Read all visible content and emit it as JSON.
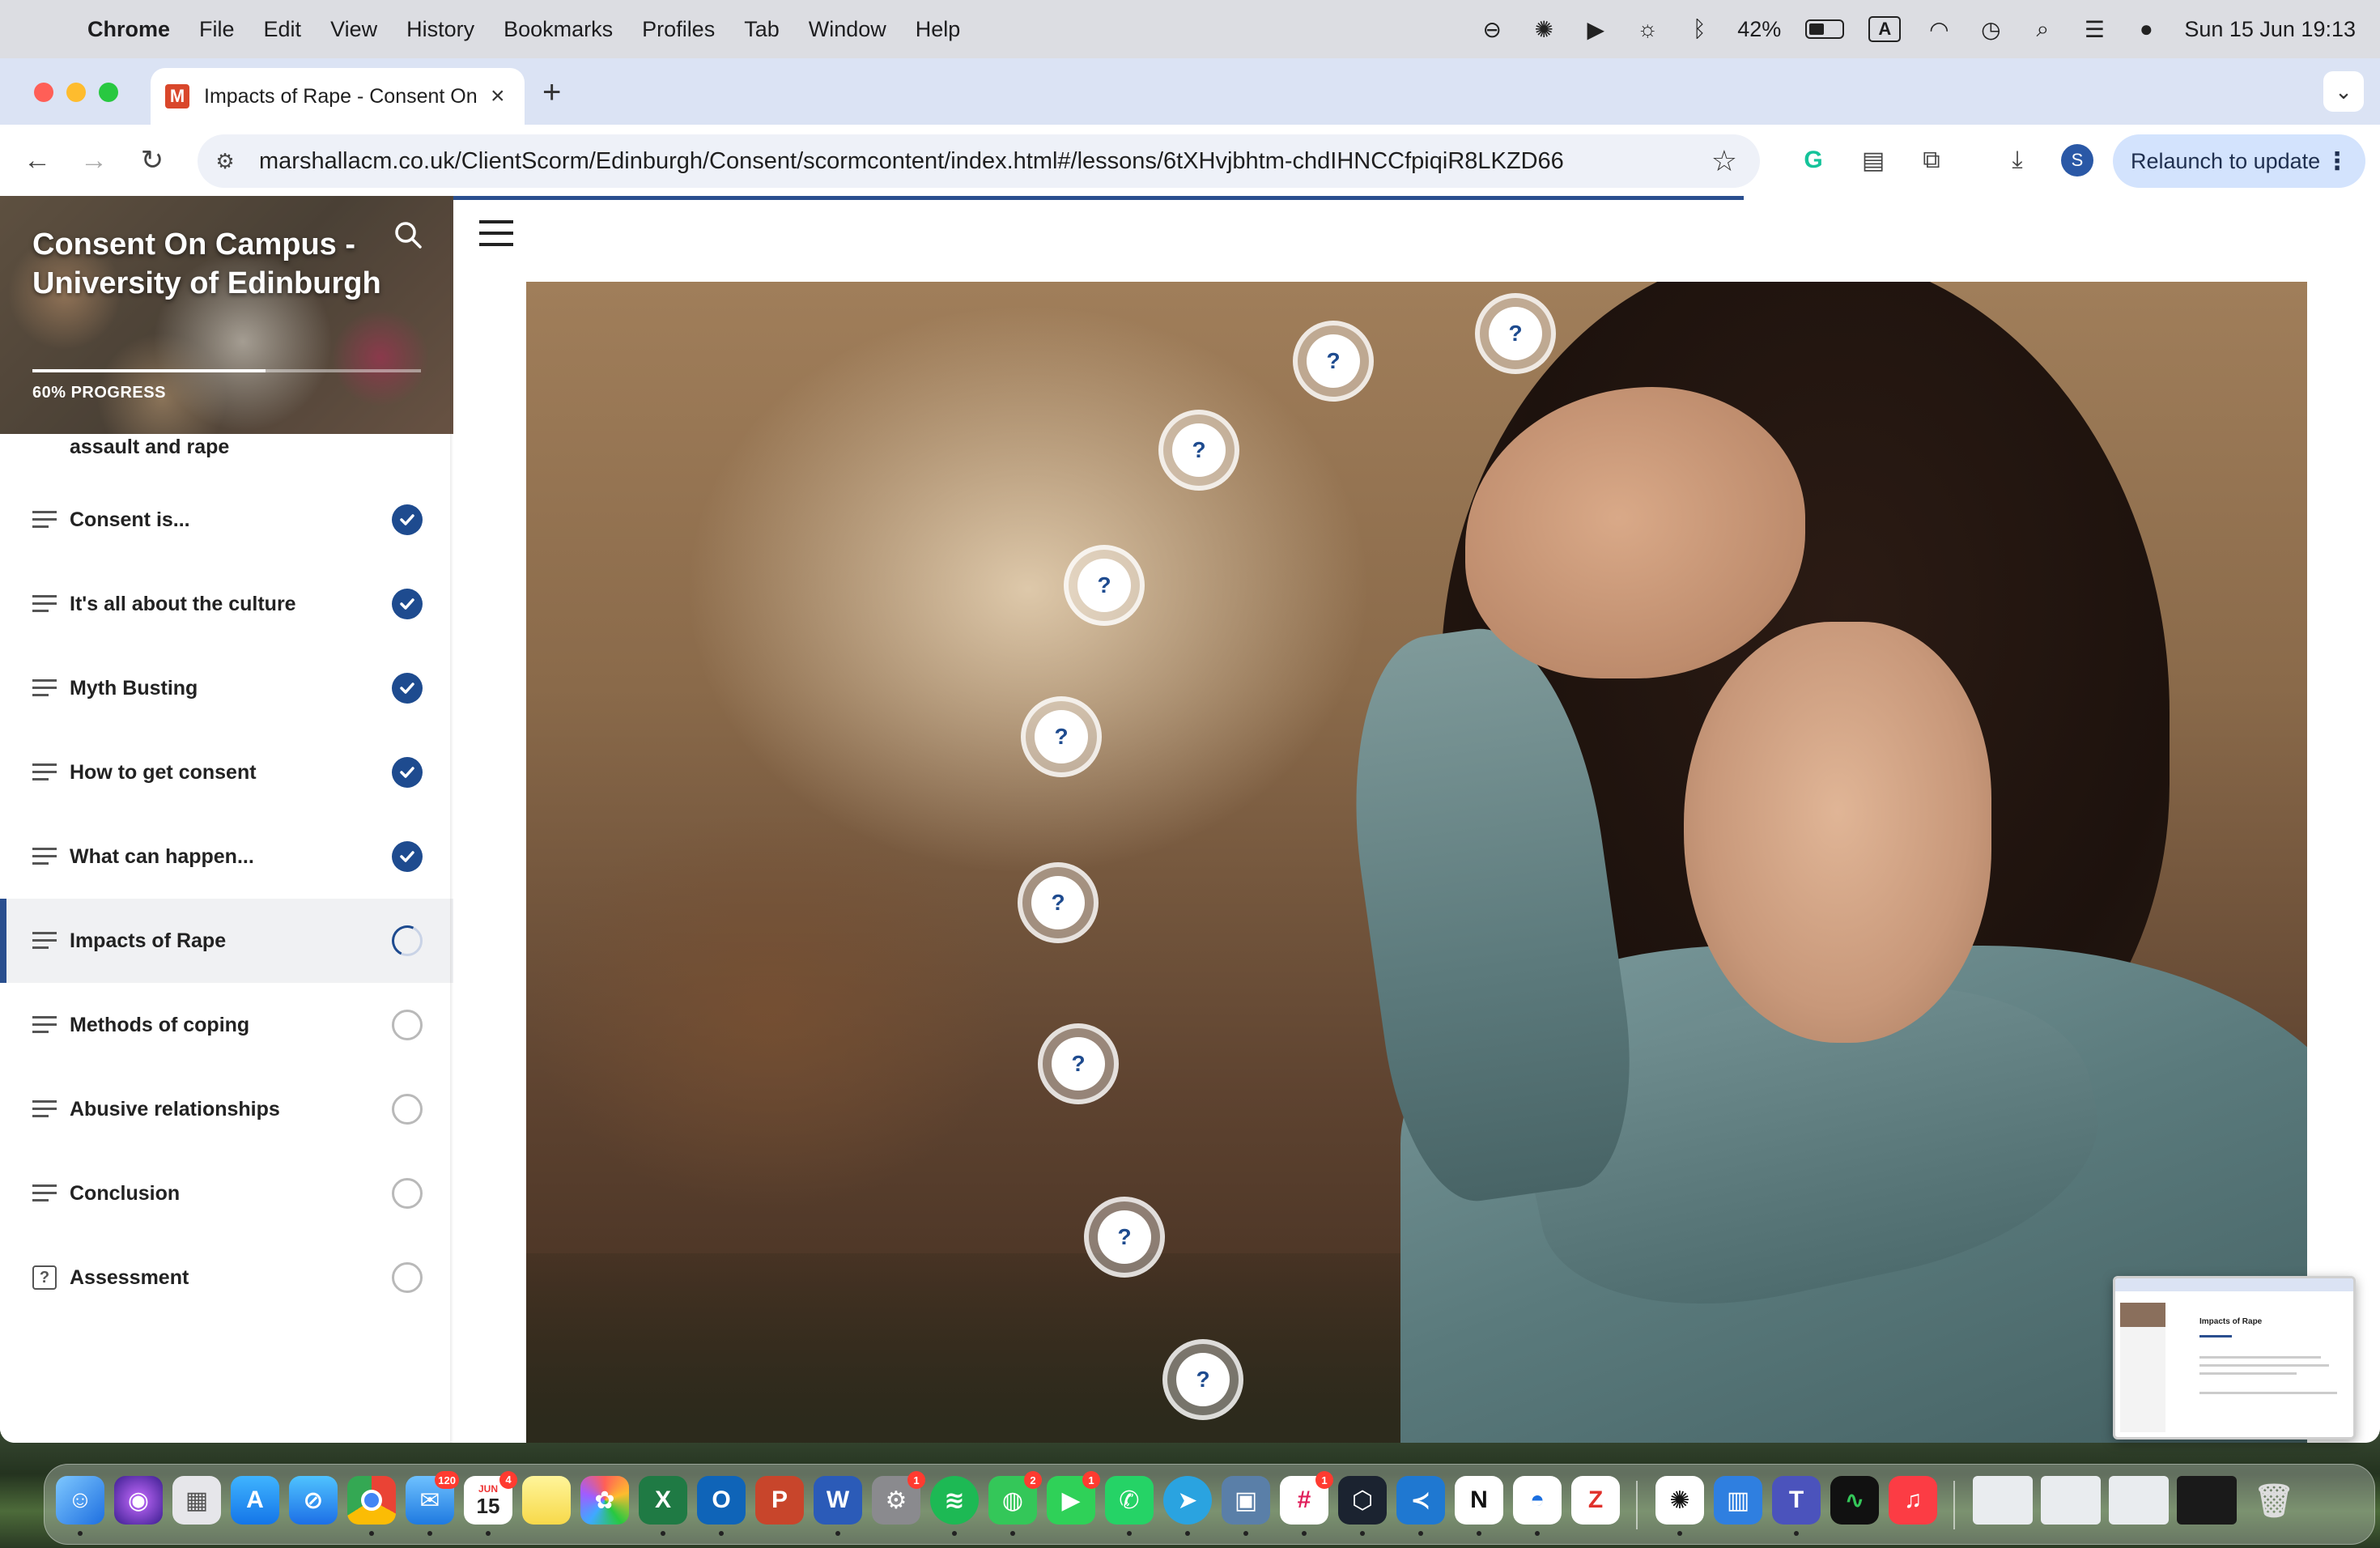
{
  "menubar": {
    "app": "Chrome",
    "items": [
      "File",
      "Edit",
      "View",
      "History",
      "Bookmarks",
      "Profiles",
      "Tab",
      "Window",
      "Help"
    ],
    "battery_percent": "42%",
    "input_indicator": "A",
    "datetime": "Sun 15 Jun  19:13"
  },
  "browser": {
    "tab": {
      "favicon_letter": "M",
      "title": "Impacts of Rape - Consent On Campus",
      "favicon_color": "#d9472b"
    },
    "url": "marshallacm.co.uk/ClientScorm/Edinburgh/Consent/scormcontent/index.html#/lessons/6tXHvjbhtm-chdIHNCCfpiqiR8LKZD66",
    "profile_initial": "S",
    "relaunch_label": "Relaunch to update"
  },
  "course": {
    "title": "Consent On Campus - University of Edinburgh",
    "progress_label": "60% PROGRESS",
    "progress_fraction": 0.6,
    "partial_item": "assault and rape",
    "lessons": [
      {
        "label": "Consent is...",
        "status": "done"
      },
      {
        "label": "It's all about the culture",
        "status": "done"
      },
      {
        "label": "Myth Busting",
        "status": "done"
      },
      {
        "label": "How to get consent",
        "status": "done"
      },
      {
        "label": "What can happen...",
        "status": "done"
      },
      {
        "label": "Impacts of Rape",
        "status": "in-progress"
      },
      {
        "label": "Methods of coping",
        "status": "todo"
      },
      {
        "label": "Abusive relationships",
        "status": "todo"
      },
      {
        "label": "Conclusion",
        "status": "todo"
      },
      {
        "label": "Assessment",
        "status": "todo"
      }
    ],
    "accent_color": "#1e4b8f"
  },
  "hero": {
    "hotspot_glyph": "?",
    "hotspot_count": 10
  },
  "pip_preview": {
    "title": "Impacts of Rape"
  },
  "dock": {
    "badges": {
      "mail": "120",
      "calendar_month": "JUN",
      "calendar_day": "15",
      "calendar_badge": "4",
      "settings": "1",
      "messages": "2",
      "facetime": "1",
      "slack": "1"
    }
  }
}
